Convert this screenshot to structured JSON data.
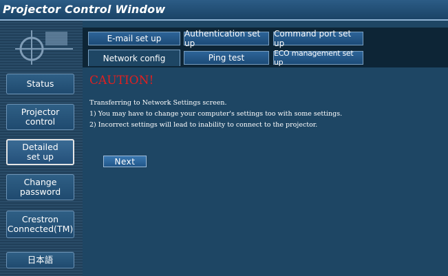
{
  "window": {
    "title": "Projector Control Window"
  },
  "sidebar": {
    "items": [
      {
        "label": "Status"
      },
      {
        "label": "Projector\ncontrol"
      },
      {
        "label": "Detailed\nset up"
      },
      {
        "label": "Change\npassword"
      },
      {
        "label": "Crestron\nConnected(TM)"
      },
      {
        "label": "日本語"
      }
    ]
  },
  "tabs": {
    "row1": [
      "E-mail set up",
      "Authentication set up",
      "Command port set up"
    ],
    "row2": [
      "Network config",
      "Ping test",
      "ECO management set up"
    ]
  },
  "main": {
    "caution": "CAUTION!",
    "lines": [
      "Transferring to Network Settings screen.",
      "1)  You may have to change your computer's settings too with some settings.",
      "2)  Incorrect settings will lead to inability to connect to the projector."
    ],
    "next_label": "Next"
  }
}
